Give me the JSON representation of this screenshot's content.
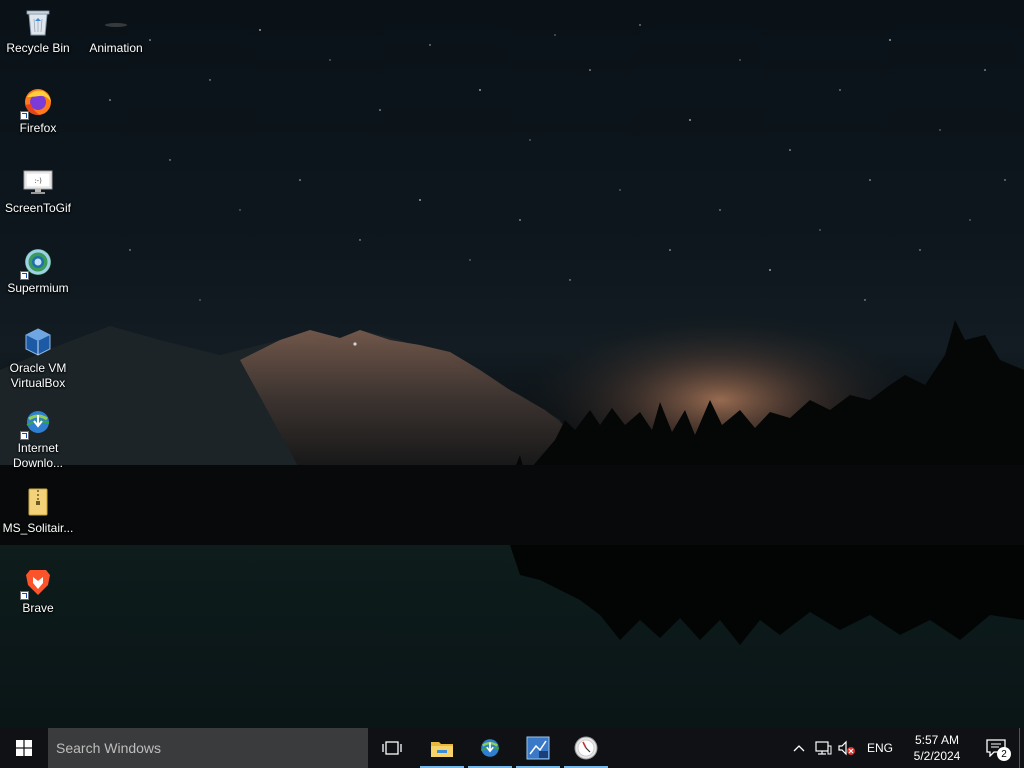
{
  "desktop": {
    "icons": [
      {
        "label": "Recycle Bin",
        "icon": "recycle-bin-icon"
      },
      {
        "label": "Animation",
        "icon": "blank-file-icon"
      },
      {
        "label": "Firefox",
        "icon": "firefox-icon"
      },
      {
        "label": "ScreenToGif",
        "icon": "screentogif-icon"
      },
      {
        "label": "Supermium",
        "icon": "supermium-icon"
      },
      {
        "label": "Oracle VM VirtualBox",
        "icon": "virtualbox-icon"
      },
      {
        "label": "Internet Downlo...",
        "icon": "internet-download-manager-icon"
      },
      {
        "label": "MS_Solitair...",
        "icon": "folder-zip-icon"
      },
      {
        "label": "Brave",
        "icon": "brave-icon"
      }
    ]
  },
  "taskbar": {
    "start_icon": "windows-logo-icon",
    "search_placeholder": "Search Windows",
    "task_view_icon": "task-view-icon",
    "pinned": [
      {
        "name": "File Explorer",
        "icon": "file-explorer-icon"
      },
      {
        "name": "Internet Download Manager",
        "icon": "internet-download-manager-icon"
      },
      {
        "name": "XP App",
        "icon": "xp-app-icon"
      },
      {
        "name": "Clock App",
        "icon": "clock-app-icon"
      }
    ],
    "tray": {
      "language": "ENG",
      "time": "5:57 AM",
      "date": "5/2/2024",
      "notification_count": "2"
    }
  },
  "colors": {
    "taskbar_bg": "#101114",
    "search_bg": "#3a3b3d",
    "running_indicator": "#76b9ed",
    "desktop_text": "#ffffff"
  }
}
